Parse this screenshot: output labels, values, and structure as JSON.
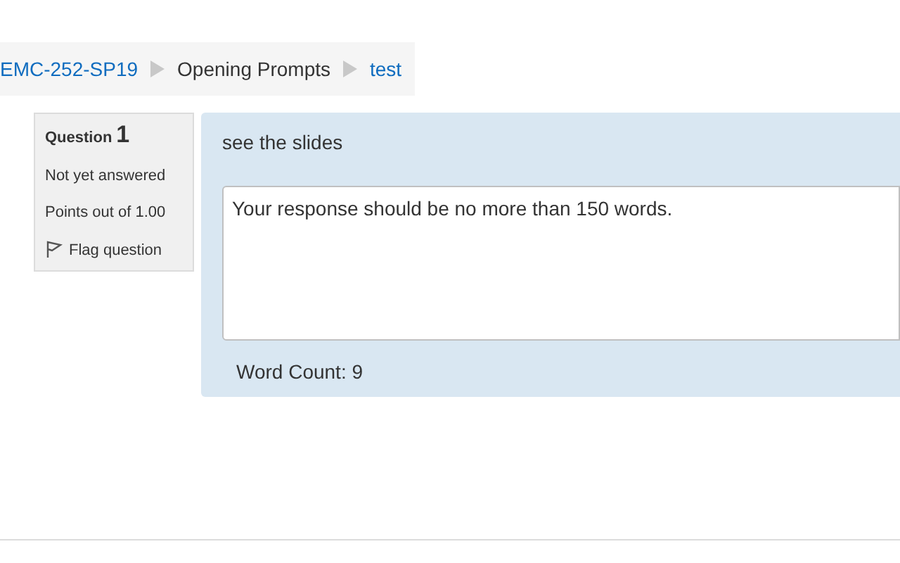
{
  "breadcrumb": [
    {
      "label": "EMC-252-SP19",
      "kind": "link"
    },
    {
      "label": "Opening Prompts",
      "kind": "text"
    },
    {
      "label": "test",
      "kind": "link"
    }
  ],
  "question_info": {
    "label": "Question",
    "number": "1",
    "status": "Not yet answered",
    "points": "Points out of 1.00",
    "flag": "Flag question"
  },
  "question": {
    "text": "see the slides",
    "response": "Your response should be no more than 150 words.",
    "word_count": "Word Count: 9"
  }
}
